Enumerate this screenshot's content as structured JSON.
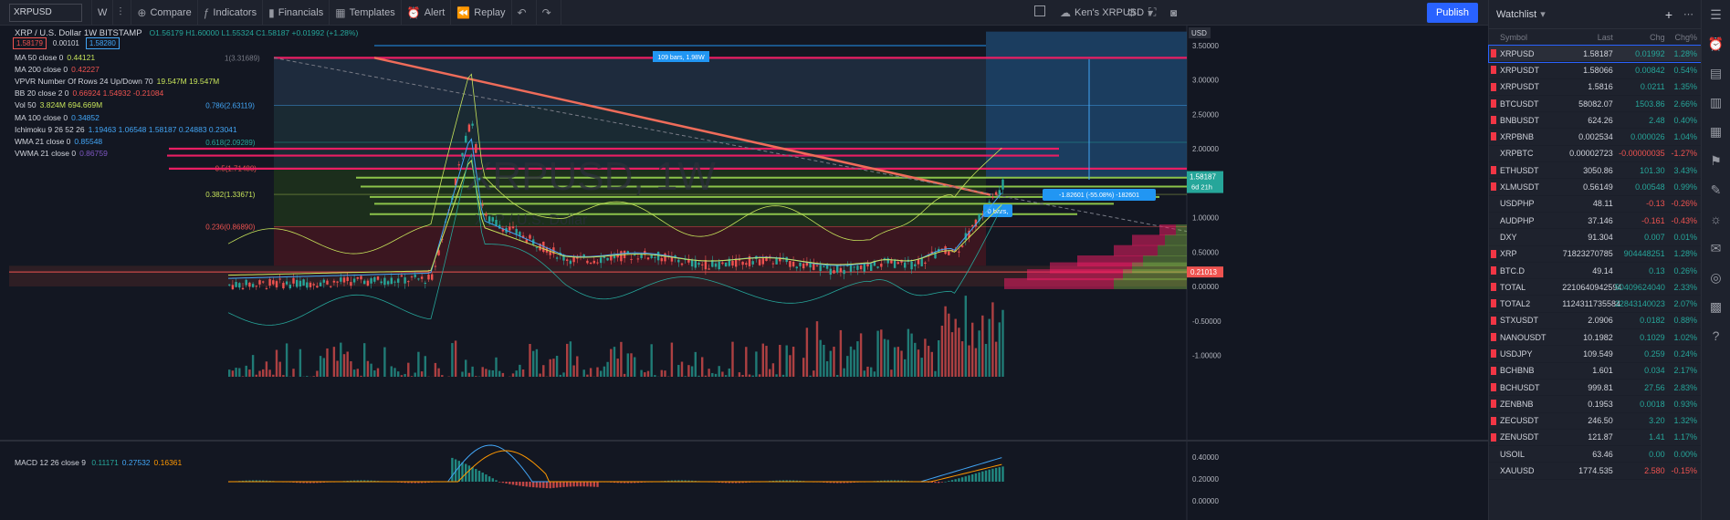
{
  "toolbar": {
    "symbol_value": "XRPUSD",
    "interval": "W",
    "items": [
      {
        "name": "compare",
        "icon": "plus-circle-icon",
        "label": "Compare"
      },
      {
        "name": "indicators",
        "icon": "indicator-icon",
        "label": "Indicators"
      },
      {
        "name": "financials",
        "icon": "financials-icon",
        "label": "Financials"
      },
      {
        "name": "templates",
        "icon": "templates-icon",
        "label": "Templates"
      },
      {
        "name": "alert",
        "icon": "alarm-icon",
        "label": "Alert"
      },
      {
        "name": "replay",
        "icon": "replay-icon",
        "label": "Replay"
      }
    ],
    "layout_name": "Ken's XRPUSD",
    "publish_label": "Publish"
  },
  "legend": {
    "title": "XRP / U.S. Dollar  1W  BITSTAMP",
    "ohlc": "O1.56179 H1.60000 L1.55324 C1.58187 +0.01992 (+1.28%)",
    "bid": "1.58179",
    "spread": "0.00101",
    "ask": "1.58280",
    "lines": [
      {
        "label": "MA 50 close 0",
        "values": "0.44121",
        "color": "#c6e35a"
      },
      {
        "label": "MA 200 close 0",
        "values": "0.42227",
        "color": "#ef5350"
      },
      {
        "label": "VPVR Number Of Rows 24 Up/Down 70",
        "values": "19.547M  19.547M",
        "color": "#c6e35a"
      },
      {
        "label": "BB 20 close 2 0",
        "values": "0.66924  1.54932  -0.21084",
        "color": "#ef5350"
      },
      {
        "label": "Vol 50",
        "values": "3.824M  694.669M",
        "color": "#c6e35a"
      },
      {
        "label": "MA 100 close 0",
        "values": "0.34852",
        "color": "#42a5f5"
      },
      {
        "label": "Ichimoku 9 26 52 26",
        "values": "1.19463  1.06548  1.58187  0.24883  0.23041",
        "color": "#42a5f5"
      },
      {
        "label": "WMA 21 close 0",
        "values": "0.85548",
        "color": "#42a5f5"
      },
      {
        "label": "VWMA 21 close 0",
        "values": "0.86759",
        "color": "#7e57c2"
      }
    ],
    "watermark": "XRPUSD, 1W",
    "watermark_sub": "XRP / U.S. Dollar",
    "macd_label": "MACD 12 26 close 9",
    "macd_values": [
      {
        "v": "0.11171",
        "c": "#26a69a"
      },
      {
        "v": "0.27532",
        "c": "#42a5f5"
      },
      {
        "v": "0.16361",
        "c": "#ff9800"
      }
    ]
  },
  "price_axis": {
    "currency": "USD",
    "ticks": [
      "3.50000",
      "3.00000",
      "2.50000",
      "2.00000",
      "1.50000",
      "1.00000",
      "0.50000",
      "0.00000",
      "-0.50000",
      "-1.00000"
    ],
    "current_price": "1.58187",
    "countdown": "6d 21h",
    "low_tag": "0.21013",
    "macd_ticks": [
      "0.40000",
      "0.20000",
      "0.00000"
    ]
  },
  "fib_labels": [
    "1(3.31689)",
    "0.786(2.63119)",
    "0.618(2.09289)",
    "0.5(1.71480)",
    "0.382(1.33671)",
    "0.236(0.86890)"
  ],
  "drawings": {
    "measure_top": "109 bars, 1.98W",
    "measure_right": "-1.82601 (-55.08%) -182601",
    "zero_bars": "0 bars,"
  },
  "watchlist": {
    "title": "Watchlist",
    "columns": [
      "Symbol",
      "Last",
      "Chg",
      "Chg%"
    ],
    "rows": [
      {
        "s": "XRPUSD",
        "l": "1.58187",
        "c": "0.01992",
        "p": "1.28%",
        "d": "pos"
      },
      {
        "s": "XRPUSDT",
        "l": "1.58066",
        "c": "0.00842",
        "p": "0.54%",
        "d": "pos"
      },
      {
        "s": "XRPUSDT",
        "l": "1.5816",
        "c": "0.0211",
        "p": "1.35%",
        "d": "pos"
      },
      {
        "s": "BTCUSDT",
        "l": "58082.07",
        "c": "1503.86",
        "p": "2.66%",
        "d": "pos"
      },
      {
        "s": "BNBUSDT",
        "l": "624.26",
        "c": "2.48",
        "p": "0.40%",
        "d": "pos"
      },
      {
        "s": "XRPBNB",
        "l": "0.002534",
        "c": "0.000026",
        "p": "1.04%",
        "d": "pos"
      },
      {
        "s": "XRPBTC",
        "l": "0.00002723",
        "c": "-0.00000035",
        "p": "-1.27%",
        "d": "neg"
      },
      {
        "s": "ETHUSDT",
        "l": "3050.86",
        "c": "101.30",
        "p": "3.43%",
        "d": "pos"
      },
      {
        "s": "XLMUSDT",
        "l": "0.56149",
        "c": "0.00548",
        "p": "0.99%",
        "d": "pos"
      },
      {
        "s": "USDPHP",
        "l": "48.11",
        "c": "-0.13",
        "p": "-0.26%",
        "d": "neg"
      },
      {
        "s": "AUDPHP",
        "l": "37.146",
        "c": "-0.161",
        "p": "-0.43%",
        "d": "neg"
      },
      {
        "s": "DXY",
        "l": "91.304",
        "c": "0.007",
        "p": "0.01%",
        "d": "pos"
      },
      {
        "s": "XRP",
        "l": "71823270785",
        "c": "904448251",
        "p": "1.28%",
        "d": "pos"
      },
      {
        "s": "BTC.D",
        "l": "49.14",
        "c": "0.13",
        "p": "0.26%",
        "d": "pos"
      },
      {
        "s": "TOTAL",
        "l": "2210640942594",
        "c": "50409624040",
        "p": "2.33%",
        "d": "pos"
      },
      {
        "s": "TOTAL2",
        "l": "1124311735584",
        "c": "22843140023",
        "p": "2.07%",
        "d": "pos"
      },
      {
        "s": "STXUSDT",
        "l": "2.0906",
        "c": "0.0182",
        "p": "0.88%",
        "d": "pos"
      },
      {
        "s": "NANOUSDT",
        "l": "10.1982",
        "c": "0.1029",
        "p": "1.02%",
        "d": "pos"
      },
      {
        "s": "USDJPY",
        "l": "109.549",
        "c": "0.259",
        "p": "0.24%",
        "d": "pos"
      },
      {
        "s": "BCHBNB",
        "l": "1.601",
        "c": "0.034",
        "p": "2.17%",
        "d": "pos"
      },
      {
        "s": "BCHUSDT",
        "l": "999.81",
        "c": "27.56",
        "p": "2.83%",
        "d": "pos"
      },
      {
        "s": "ZENBNB",
        "l": "0.1953",
        "c": "0.0018",
        "p": "0.93%",
        "d": "pos"
      },
      {
        "s": "ZECUSDT",
        "l": "246.50",
        "c": "3.20",
        "p": "1.32%",
        "d": "pos"
      },
      {
        "s": "ZENUSDT",
        "l": "121.87",
        "c": "1.41",
        "p": "1.17%",
        "d": "pos"
      },
      {
        "s": "USOIL",
        "l": "63.46",
        "c": "0.00",
        "p": "0.00%",
        "d": "pos"
      },
      {
        "s": "XAUUSD",
        "l": "1774.535",
        "c": "2.580",
        "p": "-0.15%",
        "d": "neg"
      }
    ]
  },
  "colors": {
    "bg": "#131722",
    "panel": "#1e222d",
    "up": "#26a69a",
    "down": "#ef5350",
    "accent": "#2962ff",
    "pink": "#e91e63"
  }
}
